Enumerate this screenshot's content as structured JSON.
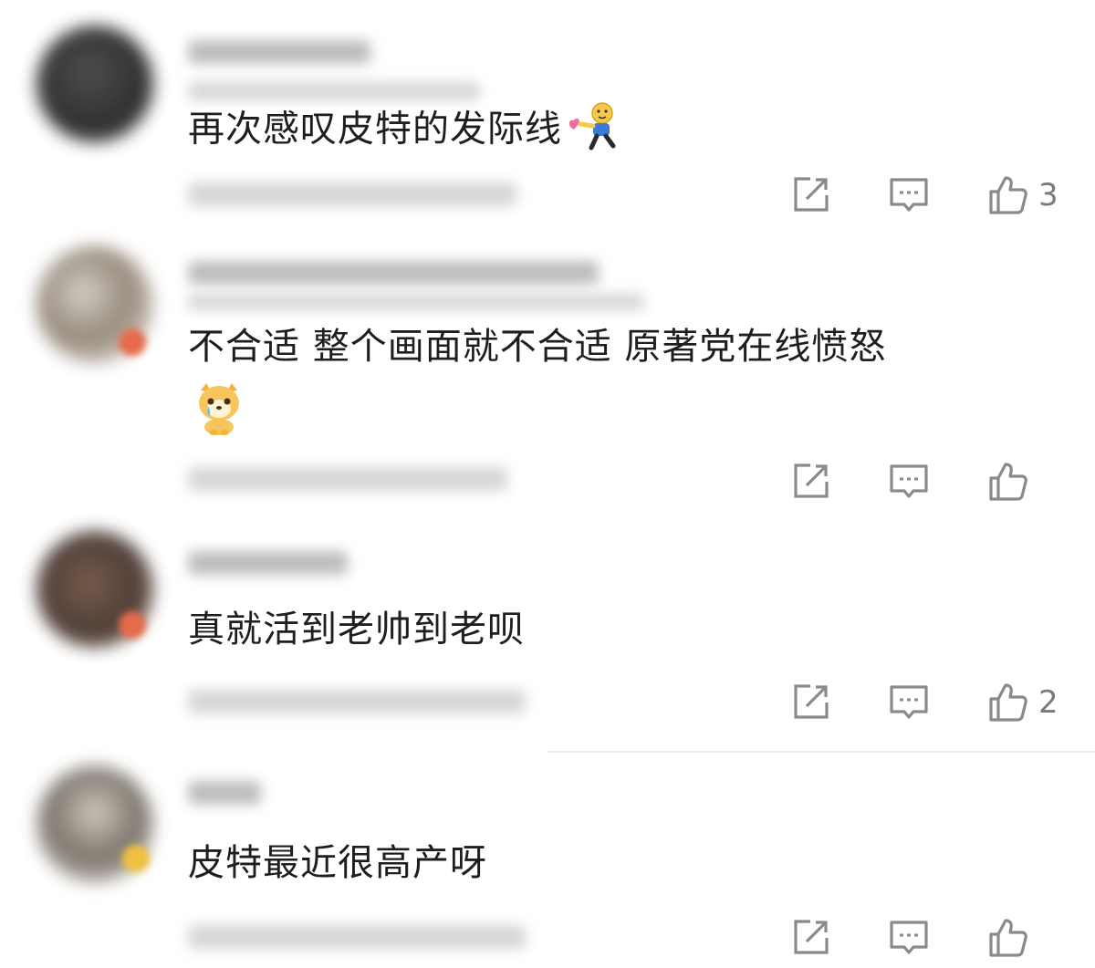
{
  "comments": [
    {
      "text": "再次感叹皮特的发际线",
      "has_emoji": "hug-emoji",
      "likes": "3",
      "accent": "#333333"
    },
    {
      "text": "不合适 整个画面就不合适 原著党在线愤怒",
      "has_emoji": "crying-dog-emoji",
      "likes": "",
      "accent": "#e86a4a"
    },
    {
      "text": "真就活到老帅到老呗",
      "has_emoji": "",
      "likes": "2",
      "accent": "#e86a4a"
    },
    {
      "text": "皮特最近很高产呀",
      "has_emoji": "",
      "likes": "",
      "accent": "#f0c040"
    }
  ],
  "icons": {
    "share": "share-icon",
    "reply": "comment-icon",
    "like": "thumbs-up-icon"
  },
  "colors": {
    "text": "#1e1e1e",
    "icon": "#8a8a8a",
    "count": "#7a7a7a"
  }
}
